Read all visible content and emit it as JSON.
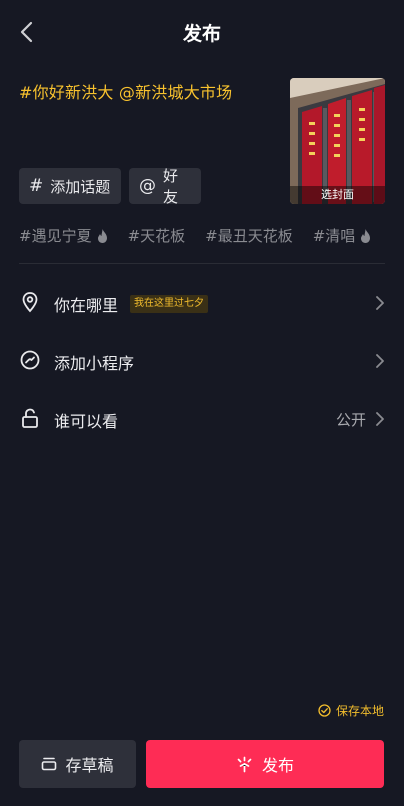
{
  "header": {
    "title": "发布"
  },
  "caption": "#你好新洪大 @新洪城大市场",
  "cover": {
    "label": "选封面"
  },
  "chips": [
    {
      "icon": "hashtag-icon",
      "symbol": "#",
      "label": "添加话题"
    },
    {
      "icon": "at-icon",
      "symbol": "@",
      "label": "好友"
    }
  ],
  "topics": [
    {
      "label": "#遇见宁夏",
      "hot": true
    },
    {
      "label": "#天花板",
      "hot": false
    },
    {
      "label": "#最丑天花板",
      "hot": false
    },
    {
      "label": "#清唱",
      "hot": true
    }
  ],
  "options": {
    "location": {
      "label": "你在哪里",
      "badge": "我在这里过七夕"
    },
    "mini_program": {
      "label": "添加小程序"
    },
    "visibility": {
      "label": "谁可以看",
      "value": "公开"
    }
  },
  "save_local": "保存本地",
  "buttons": {
    "draft": "存草稿",
    "publish": "发布"
  },
  "colors": {
    "accent": "#fe2c55",
    "highlight": "#f8c22e",
    "background": "#161823"
  }
}
